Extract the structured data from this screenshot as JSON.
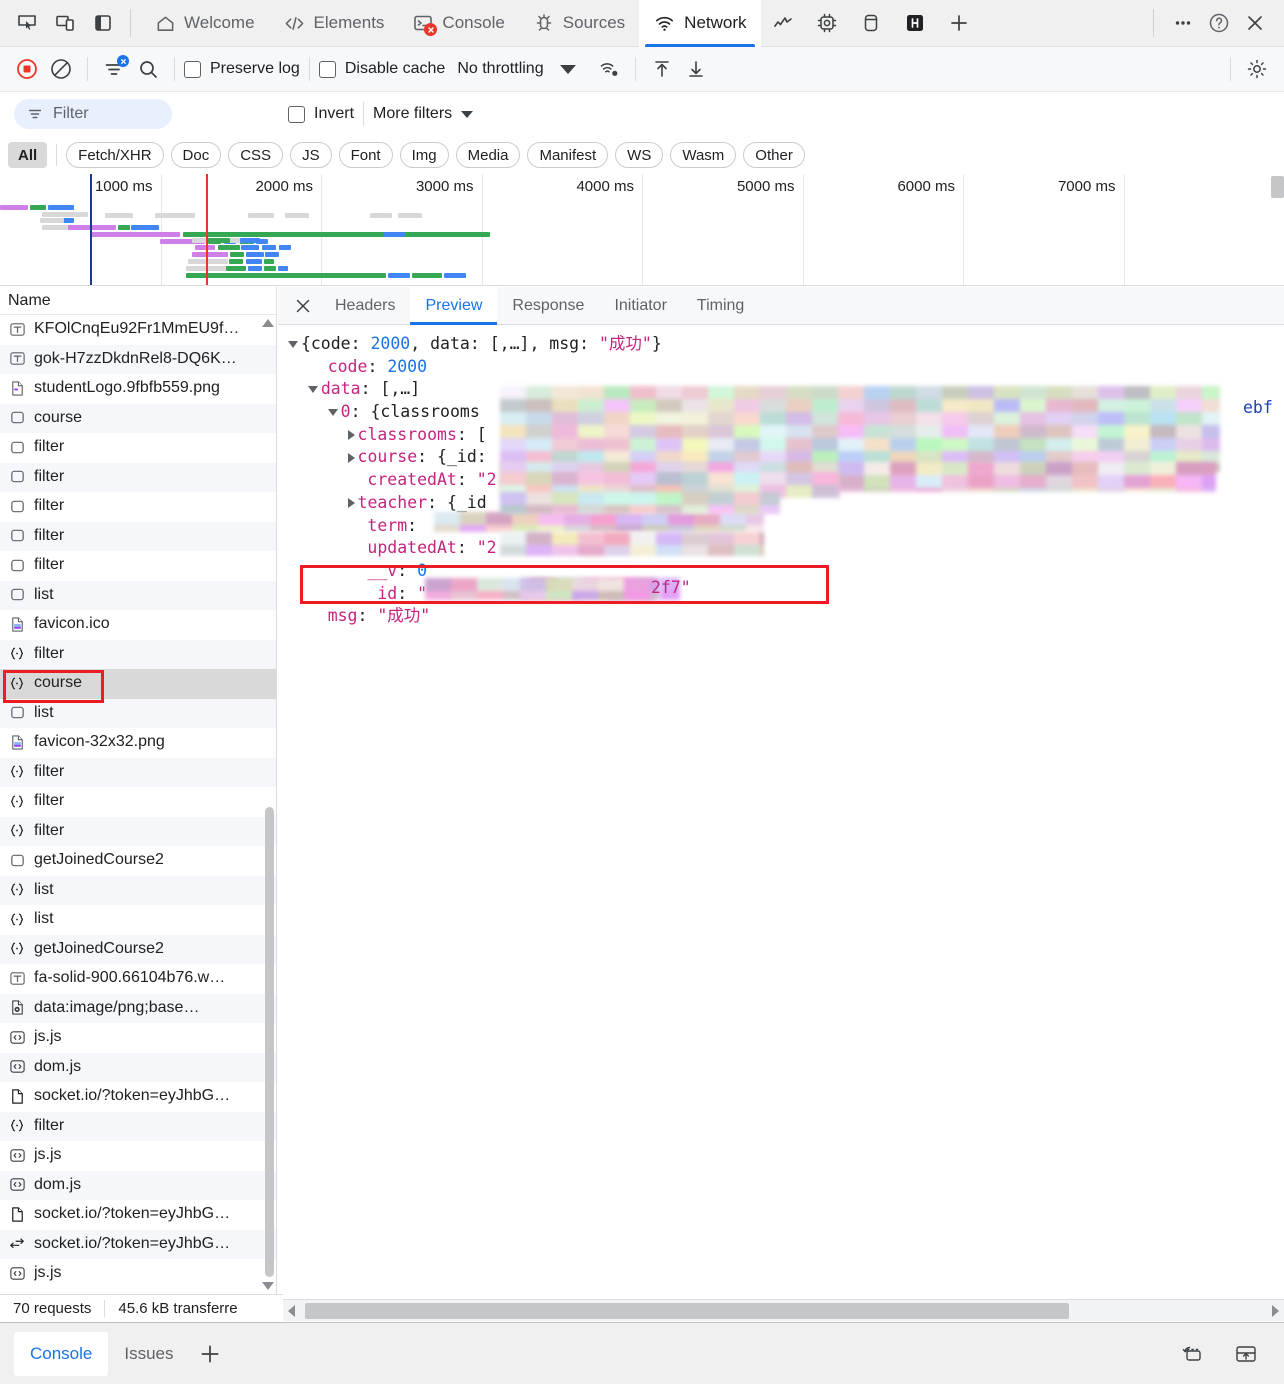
{
  "window": {
    "top_tabs": [
      {
        "label": "Welcome",
        "icon": "home-icon",
        "active": false
      },
      {
        "label": "Elements",
        "icon": "code-brackets-icon",
        "active": false
      },
      {
        "label": "Console",
        "icon": "console-prompt-icon",
        "active": false,
        "error_badge": true
      },
      {
        "label": "Sources",
        "icon": "bug-icon",
        "active": false
      },
      {
        "label": "Network",
        "icon": "wifi-icon",
        "active": true
      }
    ],
    "top_icon_tabs": [
      {
        "icon": "performance-icon"
      },
      {
        "icon": "memory-chip-icon"
      },
      {
        "icon": "application-storage-icon"
      },
      {
        "icon": "lighthouse-icon"
      }
    ],
    "left_tools": [
      {
        "icon": "inspect-element-icon"
      },
      {
        "icon": "device-toolbar-icon"
      },
      {
        "icon": "dock-side-icon"
      }
    ],
    "add_tab_label": "+",
    "right_tools": [
      {
        "icon": "more-options-icon"
      },
      {
        "icon": "help-icon"
      },
      {
        "icon": "close-icon"
      }
    ]
  },
  "network_toolbar": {
    "record_icon": "record-stop-icon",
    "clear_icon": "clear-network-icon",
    "filter_icon": "filter-active-icon",
    "search_icon": "search-icon",
    "preserve_log": {
      "label": "Preserve log",
      "checked": false
    },
    "disable_cache": {
      "label": "Disable cache",
      "checked": false
    },
    "throttling": {
      "value": "No throttling"
    },
    "network_conditions_icon": "network-conditions-icon",
    "import_icon": "import-har-icon",
    "export_icon": "export-har-icon",
    "settings_icon": "gear-icon"
  },
  "filter_row": {
    "filter_placeholder": "Filter",
    "filter_value": "",
    "invert": {
      "label": "Invert",
      "checked": false
    },
    "more_filters": "More filters"
  },
  "type_chips": [
    {
      "label": "All",
      "selected": true
    },
    {
      "label": "Fetch/XHR",
      "selected": false
    },
    {
      "label": "Doc",
      "selected": false
    },
    {
      "label": "CSS",
      "selected": false
    },
    {
      "label": "JS",
      "selected": false
    },
    {
      "label": "Font",
      "selected": false
    },
    {
      "label": "Img",
      "selected": false
    },
    {
      "label": "Media",
      "selected": false
    },
    {
      "label": "Manifest",
      "selected": false
    },
    {
      "label": "WS",
      "selected": false
    },
    {
      "label": "Wasm",
      "selected": false
    },
    {
      "label": "Other",
      "selected": false
    }
  ],
  "overview": {
    "tick_labels": [
      "1000 ms",
      "2000 ms",
      "3000 ms",
      "4000 ms",
      "5000 ms",
      "6000 ms",
      "7000 ms"
    ],
    "dom_content_loaded_marker": "blue-line",
    "load_marker": "red-line"
  },
  "request_list": {
    "column_header": "Name",
    "rows": [
      {
        "name": "KFOlCnqEu92Fr1MmEU9f…",
        "icon": "font-icon"
      },
      {
        "name": "gok-H7zzDkdnRel8-DQ6K…",
        "icon": "font-icon"
      },
      {
        "name": "studentLogo.9fbfb559.png",
        "icon": "document-icon"
      },
      {
        "name": "course",
        "icon": "fetch-icon"
      },
      {
        "name": "filter",
        "icon": "fetch-icon"
      },
      {
        "name": "filter",
        "icon": "fetch-icon"
      },
      {
        "name": "filter",
        "icon": "fetch-icon"
      },
      {
        "name": "filter",
        "icon": "fetch-icon"
      },
      {
        "name": "filter",
        "icon": "fetch-icon"
      },
      {
        "name": "list",
        "icon": "fetch-icon"
      },
      {
        "name": "favicon.ico",
        "icon": "image-icon"
      },
      {
        "name": "filter",
        "icon": "json-icon"
      },
      {
        "name": "course",
        "icon": "json-icon",
        "selected": true,
        "highlighted": true
      },
      {
        "name": "list",
        "icon": "fetch-icon"
      },
      {
        "name": "favicon-32x32.png",
        "icon": "image-icon"
      },
      {
        "name": "filter",
        "icon": "json-icon"
      },
      {
        "name": "filter",
        "icon": "json-icon"
      },
      {
        "name": "filter",
        "icon": "json-icon"
      },
      {
        "name": "getJoinedCourse2",
        "icon": "fetch-icon"
      },
      {
        "name": "list",
        "icon": "json-icon"
      },
      {
        "name": "list",
        "icon": "json-icon"
      },
      {
        "name": "getJoinedCourse2",
        "icon": "json-icon"
      },
      {
        "name": "fa-solid-900.66104b76.w…",
        "icon": "font-icon"
      },
      {
        "name": "data:image/png;base…",
        "icon": "data-image-icon"
      },
      {
        "name": "js.js",
        "icon": "script-icon"
      },
      {
        "name": "dom.js",
        "icon": "script-icon"
      },
      {
        "name": "socket.io/?token=eyJhbG…",
        "icon": "document-plain-icon"
      },
      {
        "name": "filter",
        "icon": "json-icon"
      },
      {
        "name": "js.js",
        "icon": "script-icon"
      },
      {
        "name": "dom.js",
        "icon": "script-icon"
      },
      {
        "name": "socket.io/?token=eyJhbG…",
        "icon": "document-plain-icon"
      },
      {
        "name": "socket.io/?token=eyJhbG…",
        "icon": "websocket-icon"
      },
      {
        "name": "js.js",
        "icon": "script-icon"
      }
    ]
  },
  "status_bar": {
    "requests": "70 requests",
    "transferred": "45.6 kB transferre"
  },
  "detail_pane": {
    "close_icon": "close-icon",
    "tabs": [
      {
        "label": "Headers",
        "active": false
      },
      {
        "label": "Preview",
        "active": true
      },
      {
        "label": "Response",
        "active": false
      },
      {
        "label": "Initiator",
        "active": false
      },
      {
        "label": "Timing",
        "active": false
      }
    ],
    "preview_json": {
      "lines": [
        {
          "indent": 0,
          "triangle": "open",
          "segments": [
            {
              "t": "{code: ",
              "c": "plain"
            },
            {
              "t": "2000",
              "c": "num"
            },
            {
              "t": ", data: [,…], msg: ",
              "c": "plain"
            },
            {
              "t": "\"成功\"",
              "c": "str"
            },
            {
              "t": "}",
              "c": "plain"
            }
          ]
        },
        {
          "indent": 1,
          "triangle": "none",
          "segments": [
            {
              "t": "code",
              "c": "name"
            },
            {
              "t": ": ",
              "c": "plain"
            },
            {
              "t": "2000",
              "c": "num"
            }
          ]
        },
        {
          "indent": 1,
          "triangle": "open",
          "segments": [
            {
              "t": "data",
              "c": "name"
            },
            {
              "t": ": [,…]",
              "c": "plain"
            }
          ]
        },
        {
          "indent": 2,
          "triangle": "open",
          "segments": [
            {
              "t": "0",
              "c": "name"
            },
            {
              "t": ": {classrooms",
              "c": "plain"
            }
          ]
        },
        {
          "indent": 3,
          "triangle": "closed",
          "segments": [
            {
              "t": "classrooms",
              "c": "name"
            },
            {
              "t": ": [",
              "c": "plain"
            }
          ]
        },
        {
          "indent": 3,
          "triangle": "closed",
          "segments": [
            {
              "t": "course",
              "c": "name"
            },
            {
              "t": ": {_id:",
              "c": "plain"
            }
          ]
        },
        {
          "indent": 3,
          "triangle": "none",
          "segments": [
            {
              "t": "createdAt",
              "c": "name"
            },
            {
              "t": ": ",
              "c": "plain"
            },
            {
              "t": "\"2",
              "c": "str"
            }
          ]
        },
        {
          "indent": 3,
          "triangle": "closed",
          "segments": [
            {
              "t": "teacher",
              "c": "name"
            },
            {
              "t": ": {_id",
              "c": "plain"
            }
          ]
        },
        {
          "indent": 3,
          "triangle": "none",
          "segments": [
            {
              "t": "term",
              "c": "name"
            },
            {
              "t": ":",
              "c": "plain"
            }
          ]
        },
        {
          "indent": 3,
          "triangle": "none",
          "segments": [
            {
              "t": "updatedAt",
              "c": "name"
            },
            {
              "t": ": ",
              "c": "plain"
            },
            {
              "t": "\"2",
              "c": "str"
            }
          ]
        },
        {
          "indent": 3,
          "triangle": "none",
          "segments": [
            {
              "t": "__v",
              "c": "name"
            },
            {
              "t": ": ",
              "c": "plain"
            },
            {
              "t": "0",
              "c": "num"
            }
          ]
        },
        {
          "indent": 3,
          "triangle": "none",
          "segments": [
            {
              "t": "_id",
              "c": "name"
            },
            {
              "t": ": ",
              "c": "plain"
            },
            {
              "t": "\"",
              "c": "str"
            }
          ]
        },
        {
          "indent": 1,
          "triangle": "none",
          "segments": [
            {
              "t": "msg",
              "c": "name"
            },
            {
              "t": ": ",
              "c": "plain"
            },
            {
              "t": "\"成功\"",
              "c": "str"
            }
          ]
        }
      ],
      "id_tail": "2f7\"",
      "right_overflow_text": "ebf"
    },
    "annotations": {
      "color": "#ec1c24",
      "boxes": [
        "selected-request-course",
        "id-field-row"
      ]
    }
  },
  "drawer": {
    "tabs": [
      {
        "label": "Console",
        "active": true
      },
      {
        "label": "Issues",
        "active": false
      }
    ],
    "add_label": "+",
    "right_icons": [
      {
        "icon": "restore-drawer-icon"
      },
      {
        "icon": "dock-to-bottom-icon"
      }
    ]
  },
  "colors": {
    "accent": "#1a73e8",
    "annotation_red": "#ec1c24",
    "record_red": "#e8372a",
    "json_key": "#c5247f",
    "json_number": "#1a73e8"
  }
}
